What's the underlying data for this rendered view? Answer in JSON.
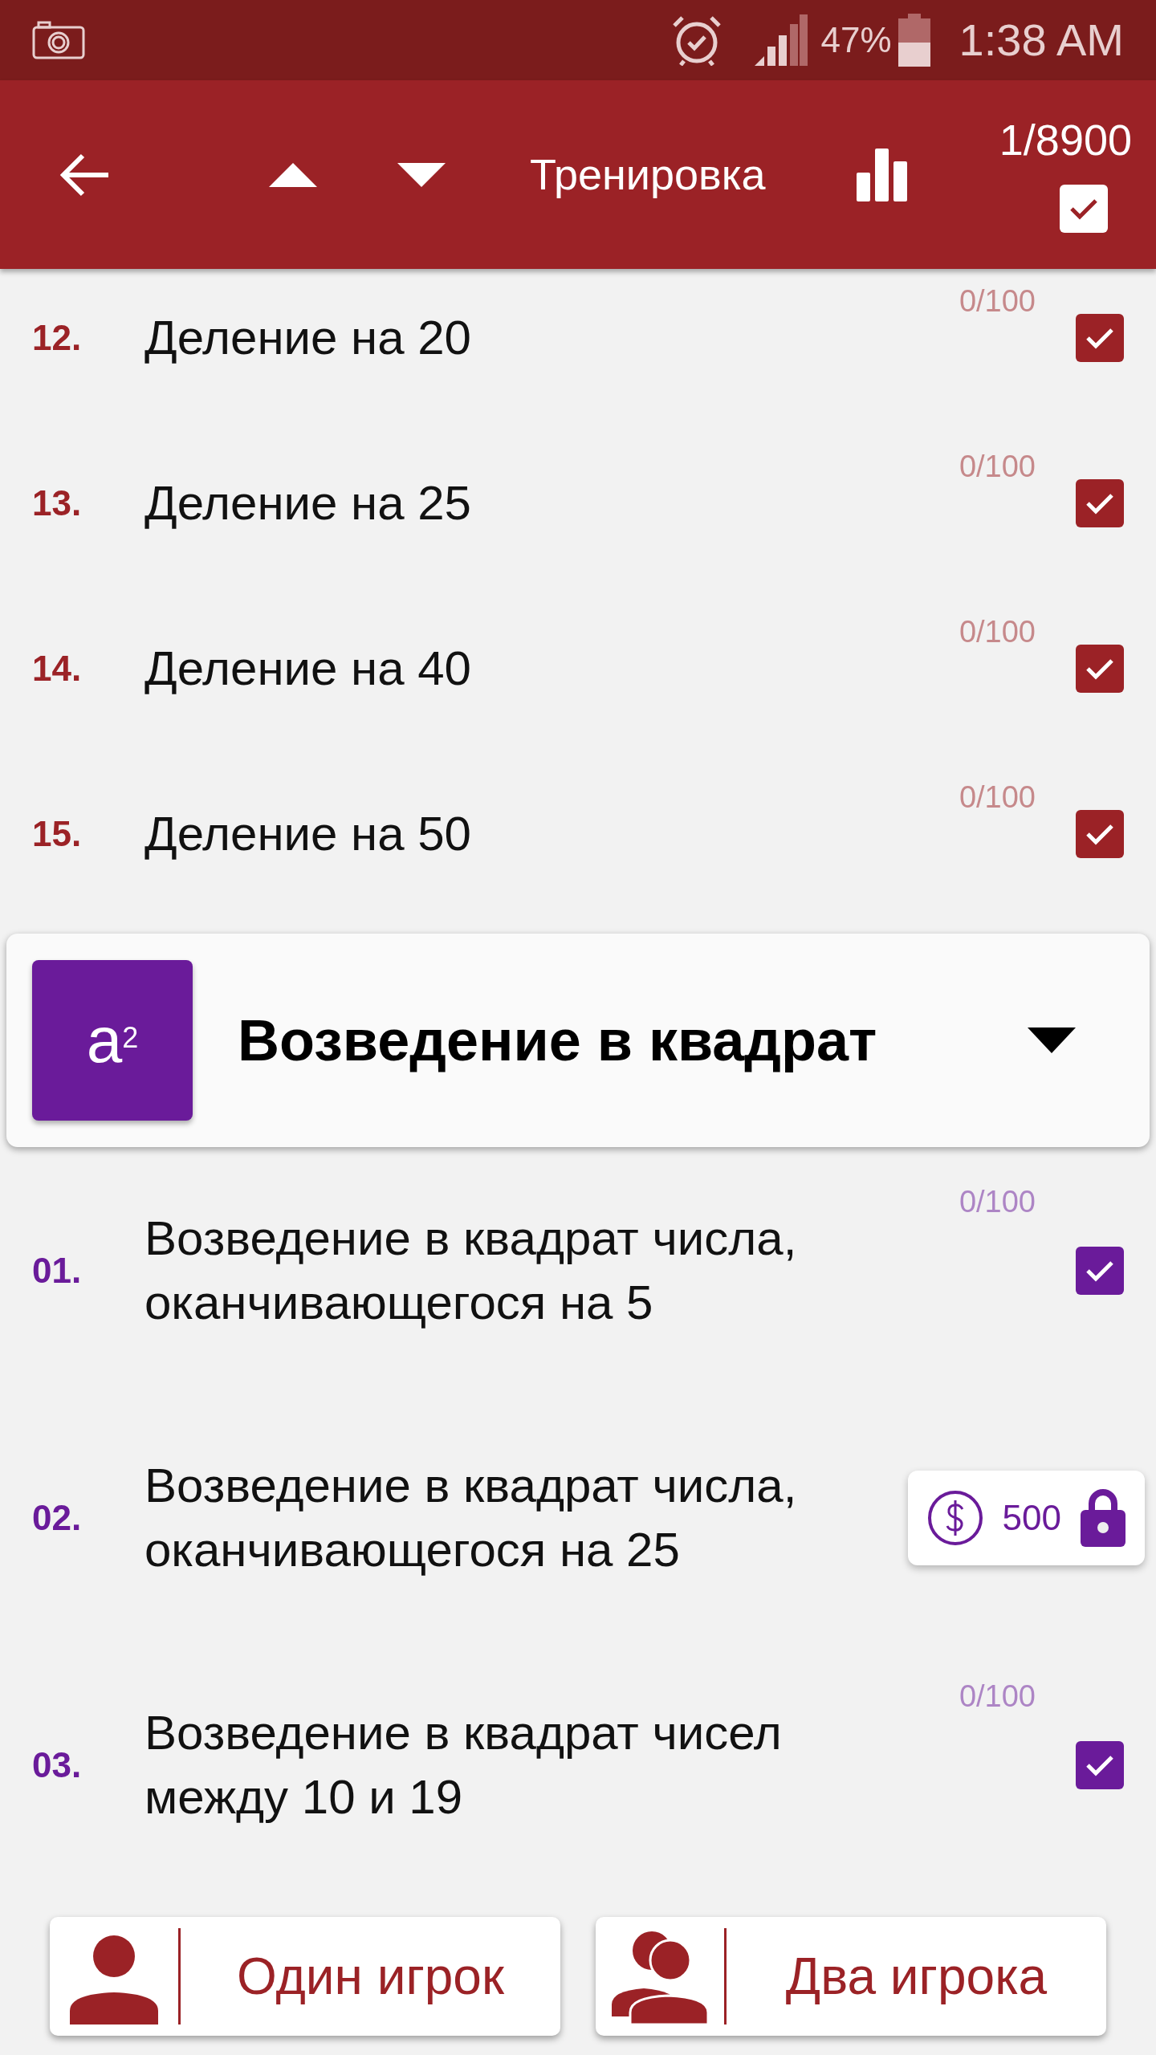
{
  "status_bar": {
    "battery": "47%",
    "time": "1:38 AM"
  },
  "toolbar": {
    "title": "Тренировка",
    "counter": "1/8900",
    "all_checked": true
  },
  "sections": [
    {
      "color": "#9b2226",
      "items": [
        {
          "kind": "task",
          "number": "12.",
          "title": "Деление на 20",
          "progress": "0/100",
          "checked": true
        },
        {
          "kind": "task",
          "number": "13.",
          "title": "Деление на 25",
          "progress": "0/100",
          "checked": true
        },
        {
          "kind": "task",
          "number": "14.",
          "title": "Деление на 40",
          "progress": "0/100",
          "checked": true
        },
        {
          "kind": "task",
          "number": "15.",
          "title": "Деление на 50",
          "progress": "0/100",
          "checked": true
        }
      ]
    },
    {
      "color": "#6a1b9a",
      "header": {
        "title": "Возведение в квадрат",
        "icon_text": "a$^{2}$"
      },
      "items": [
        {
          "kind": "task",
          "number": "01.",
          "title": "Возведение в квадрат числа, оканчивающегося на 5",
          "progress": "0/100",
          "checked": true
        },
        {
          "kind": "locked",
          "number": "02.",
          "title": "Возведение в квадрат числа, оканчивающегося на 25",
          "price": "500"
        },
        {
          "kind": "task",
          "number": "03.",
          "title": "Возведение в квадрат чисел между 10 и 19",
          "progress": "0/100",
          "checked": true
        }
      ]
    }
  ],
  "bottom_buttons": [
    {
      "kind": "single",
      "label": "Один игрок"
    },
    {
      "kind": "double",
      "label": "Два игрока"
    }
  ]
}
